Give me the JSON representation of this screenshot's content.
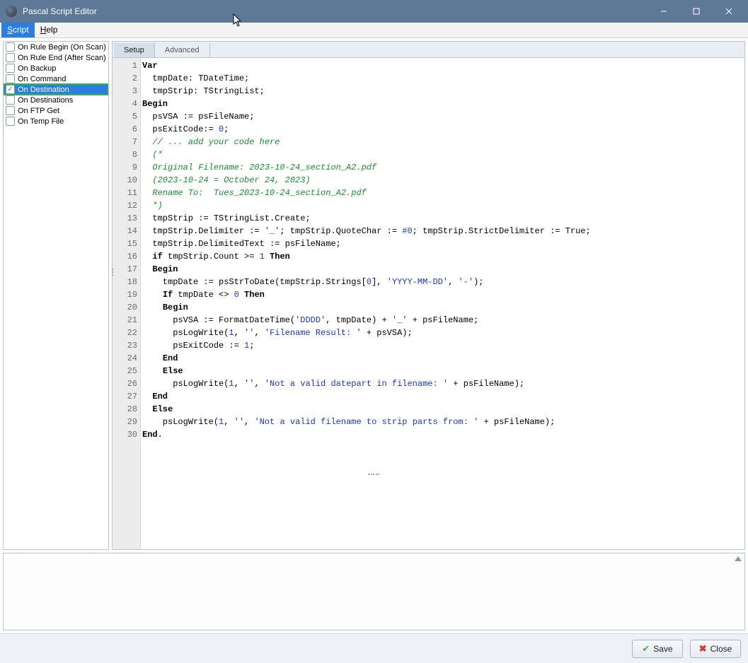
{
  "window": {
    "title": "Pascal Script Editor"
  },
  "menubar": {
    "items": [
      {
        "prefix": "S",
        "rest": "cript",
        "active": true
      },
      {
        "prefix": "H",
        "rest": "elp",
        "active": false
      }
    ]
  },
  "events": [
    {
      "label": "On Rule Begin (On Scan)",
      "checked": false,
      "selected": false
    },
    {
      "label": "On Rule End (After Scan)",
      "checked": false,
      "selected": false
    },
    {
      "label": "On Backup",
      "checked": false,
      "selected": false
    },
    {
      "label": "On Command",
      "checked": false,
      "selected": false
    },
    {
      "label": "On Destination",
      "checked": true,
      "selected": true,
      "highlight": true
    },
    {
      "label": "On Destinations",
      "checked": false,
      "selected": false
    },
    {
      "label": "On FTP Get",
      "checked": false,
      "selected": false
    },
    {
      "label": "On Temp File",
      "checked": false,
      "selected": false
    }
  ],
  "tabs": {
    "setup": "Setup",
    "advanced": "Advanced"
  },
  "code_lines": [
    {
      "n": 1,
      "html": "<span class='kw'>Var</span>"
    },
    {
      "n": 2,
      "html": "  tmpDate: TDateTime;"
    },
    {
      "n": 3,
      "html": "  tmpStrip: TStringList;"
    },
    {
      "n": 4,
      "html": "<span class='kw'>Begin</span>"
    },
    {
      "n": 5,
      "html": "  psVSA := psFileName;"
    },
    {
      "n": 6,
      "html": "  psExitCode:= <span class='num'>0</span>;"
    },
    {
      "n": 7,
      "html": "  <span class='cm'>// ... add your code here</span>"
    },
    {
      "n": 8,
      "html": "  <span class='cm'>(*</span>"
    },
    {
      "n": 9,
      "html": "  <span class='cm'>Original Filename: 2023-10-24_section_A2.pdf</span>"
    },
    {
      "n": 10,
      "html": "  <span class='cm'>(2023-10-24 = October 24, 2023)</span>"
    },
    {
      "n": 11,
      "html": "  <span class='cm'>Rename To:  Tues_2023-10-24_section_A2.pdf</span>"
    },
    {
      "n": 12,
      "html": "  <span class='cm'>*)</span>"
    },
    {
      "n": 13,
      "html": "  tmpStrip := TStringList.Create;"
    },
    {
      "n": 14,
      "html": "  tmpStrip.Delimiter := <span class='str'>'_'</span>; tmpStrip.QuoteChar := <span class='num'>#0</span>; tmpStrip.StrictDelimiter := True;"
    },
    {
      "n": 15,
      "html": "  tmpStrip.DelimitedText := psFileName;"
    },
    {
      "n": 16,
      "html": "  <span class='kw'>if</span> tmpStrip.Count &gt;= <span class='num'>1</span> <span class='kw'>Then</span>"
    },
    {
      "n": 17,
      "html": "  <span class='kw'>Begin</span>"
    },
    {
      "n": 18,
      "html": "    tmpDate := psStrToDate(tmpStrip.Strings[<span class='num'>0</span>], <span class='str'>'YYYY-MM-DD'</span>, <span class='str'>'-'</span>);"
    },
    {
      "n": 19,
      "html": "    <span class='kw'>If</span> tmpDate &lt;&gt; <span class='num'>0</span> <span class='kw'>Then</span>"
    },
    {
      "n": 20,
      "html": "    <span class='kw'>Begin</span>"
    },
    {
      "n": 21,
      "html": "      psVSA := FormatDateTime(<span class='str'>'DDDD'</span>, tmpDate) + <span class='str'>'_'</span> + psFileName;"
    },
    {
      "n": 22,
      "html": "      psLogWrite(<span class='num'>1</span>, <span class='str'>''</span>, <span class='str'>'Filename Result: '</span> + psVSA);"
    },
    {
      "n": 23,
      "html": "      psExitCode := <span class='num'>1</span>;"
    },
    {
      "n": 24,
      "html": "    <span class='kw'>End</span>"
    },
    {
      "n": 25,
      "html": "    <span class='kw'>Else</span>"
    },
    {
      "n": 26,
      "html": "      psLogWrite(<span class='num'>1</span>, <span class='str'>''</span>, <span class='str'>'Not a valid datepart in filename: '</span> + psFileName);"
    },
    {
      "n": 27,
      "html": "  <span class='kw'>End</span>"
    },
    {
      "n": 28,
      "html": "  <span class='kw'>Else</span>"
    },
    {
      "n": 29,
      "html": "    psLogWrite(<span class='num'>1</span>, <span class='str'>''</span>, <span class='str'>'Not a valid filename to strip parts from: '</span> + psFileName);"
    },
    {
      "n": 30,
      "html": "<span class='kw'>End</span>."
    }
  ],
  "footer": {
    "save": "Save",
    "close": "Close"
  }
}
